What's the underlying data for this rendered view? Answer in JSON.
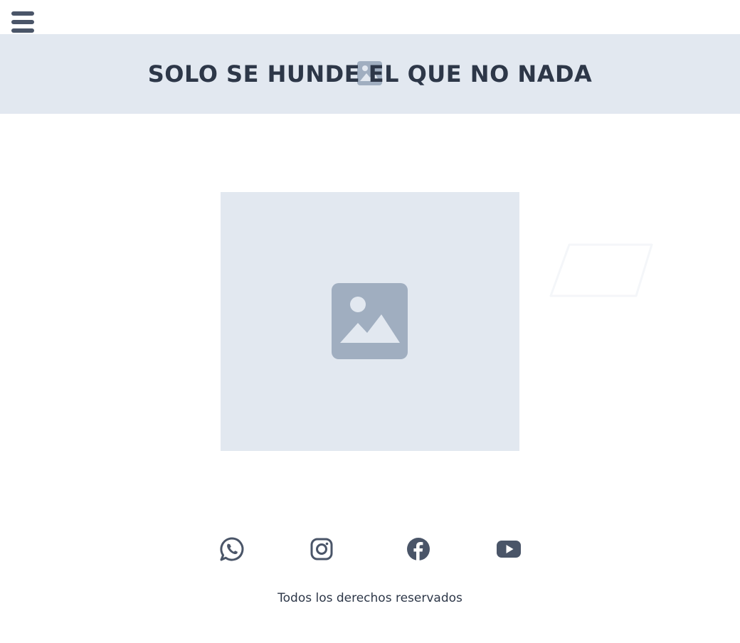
{
  "header": {
    "menu_icon": "hamburger-menu-icon"
  },
  "banner": {
    "title": "SOLO SE HUNDE EL QUE NO NADA",
    "icon": "image-placeholder-icon",
    "background": "#e2e8f0"
  },
  "main": {
    "image_icon": "image-placeholder-icon",
    "placeholder_color": "#a0aec0"
  },
  "social": {
    "items": [
      {
        "icon": "whatsapp-icon"
      },
      {
        "icon": "instagram-icon"
      },
      {
        "icon": "facebook-icon"
      },
      {
        "icon": "youtube-icon"
      }
    ],
    "color": "#4a5568"
  },
  "footer": {
    "copyright": "Todos los derechos reservados"
  }
}
